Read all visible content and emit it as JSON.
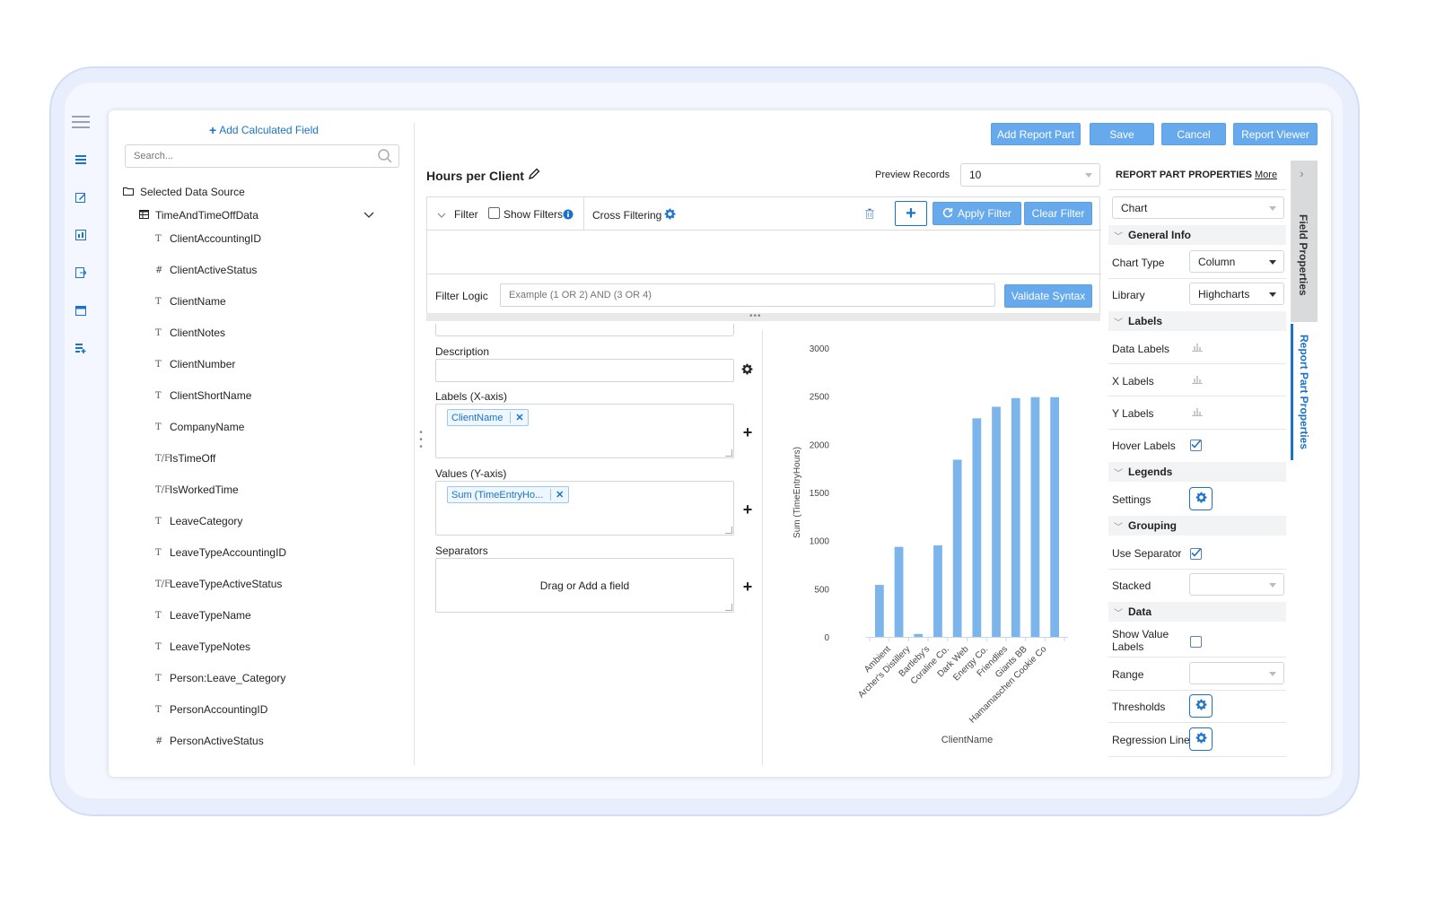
{
  "field_panel": {
    "add_calculated": "Add Calculated Field",
    "search_placeholder": "Search...",
    "selected_source": "Selected Data Source",
    "table_name": "TimeAndTimeOffData",
    "fields": [
      {
        "type": "T",
        "name": "ClientAccountingID"
      },
      {
        "type": "#",
        "name": "ClientActiveStatus"
      },
      {
        "type": "T",
        "name": "ClientName"
      },
      {
        "type": "T",
        "name": "ClientNotes"
      },
      {
        "type": "T",
        "name": "ClientNumber"
      },
      {
        "type": "T",
        "name": "ClientShortName"
      },
      {
        "type": "T",
        "name": "CompanyName"
      },
      {
        "type": "T/F",
        "name": "IsTimeOff"
      },
      {
        "type": "T/F",
        "name": "IsWorkedTime"
      },
      {
        "type": "T",
        "name": "LeaveCategory"
      },
      {
        "type": "T",
        "name": "LeaveTypeAccountingID"
      },
      {
        "type": "T/F",
        "name": "LeaveTypeActiveStatus"
      },
      {
        "type": "T",
        "name": "LeaveTypeName"
      },
      {
        "type": "T",
        "name": "LeaveTypeNotes"
      },
      {
        "type": "T",
        "name": "Person:Leave_Category"
      },
      {
        "type": "T",
        "name": "PersonAccountingID"
      },
      {
        "type": "#",
        "name": "PersonActiveStatus"
      }
    ]
  },
  "toolbar": {
    "add_report_part": "Add Report Part",
    "save": "Save",
    "cancel": "Cancel",
    "report_viewer": "Report Viewer"
  },
  "report": {
    "title": "Hours per Client",
    "preview_label": "Preview Records",
    "preview_value": "10"
  },
  "filter": {
    "label": "Filter",
    "show_filters": "Show Filters",
    "cross_filtering": "Cross Filtering",
    "apply": "Apply Filter",
    "clear": "Clear Filter",
    "logic_label": "Filter Logic",
    "logic_placeholder": "Example (1 OR 2) AND (3 OR 4)",
    "validate": "Validate Syntax"
  },
  "designer": {
    "description_label": "Description",
    "labels_label": "Labels (X-axis)",
    "labels_chip": "ClientName",
    "values_label": "Values (Y-axis)",
    "values_chip": "Sum (TimeEntryHo...",
    "separators_label": "Separators",
    "separators_placeholder": "Drag or Add a field"
  },
  "chart_data": {
    "type": "bar",
    "categories": [
      "Ambient",
      "Archer's Distillery",
      "Bartleby's",
      "Coraline Co.",
      "Dark Web",
      "Energy Co.",
      "Friendlies",
      "Giants BB",
      "Hamamaschen Cookie Co"
    ],
    "values": [
      540,
      935,
      30,
      950,
      1840,
      2270,
      2390,
      2480,
      2490,
      2490
    ],
    "xlabel": "ClientName",
    "ylabel": "Sum (TimeEntryHours)",
    "ylim": [
      0,
      3000
    ],
    "yticks": [
      0,
      500,
      1000,
      1500,
      2000,
      2500,
      3000
    ],
    "color": "#7cb5ec",
    "grid": false,
    "legend": "none"
  },
  "properties": {
    "header": "REPORT PART PROPERTIES",
    "more": "More",
    "part_type": "Chart",
    "tab_field": "Field Properties",
    "tab_report": "Report Part Properties",
    "general_info": "General Info",
    "chart_type_label": "Chart Type",
    "chart_type_value": "Column",
    "library_label": "Library",
    "library_value": "Highcharts",
    "labels_section": "Labels",
    "data_labels": "Data Labels",
    "x_labels": "X Labels",
    "y_labels": "Y Labels",
    "hover_labels": "Hover Labels",
    "legends_section": "Legends",
    "settings": "Settings",
    "grouping_section": "Grouping",
    "use_separator": "Use Separator",
    "stacked": "Stacked",
    "data_section": "Data",
    "show_value_labels": "Show Value Labels",
    "range": "Range",
    "thresholds": "Thresholds",
    "regression_line": "Regression Line"
  }
}
